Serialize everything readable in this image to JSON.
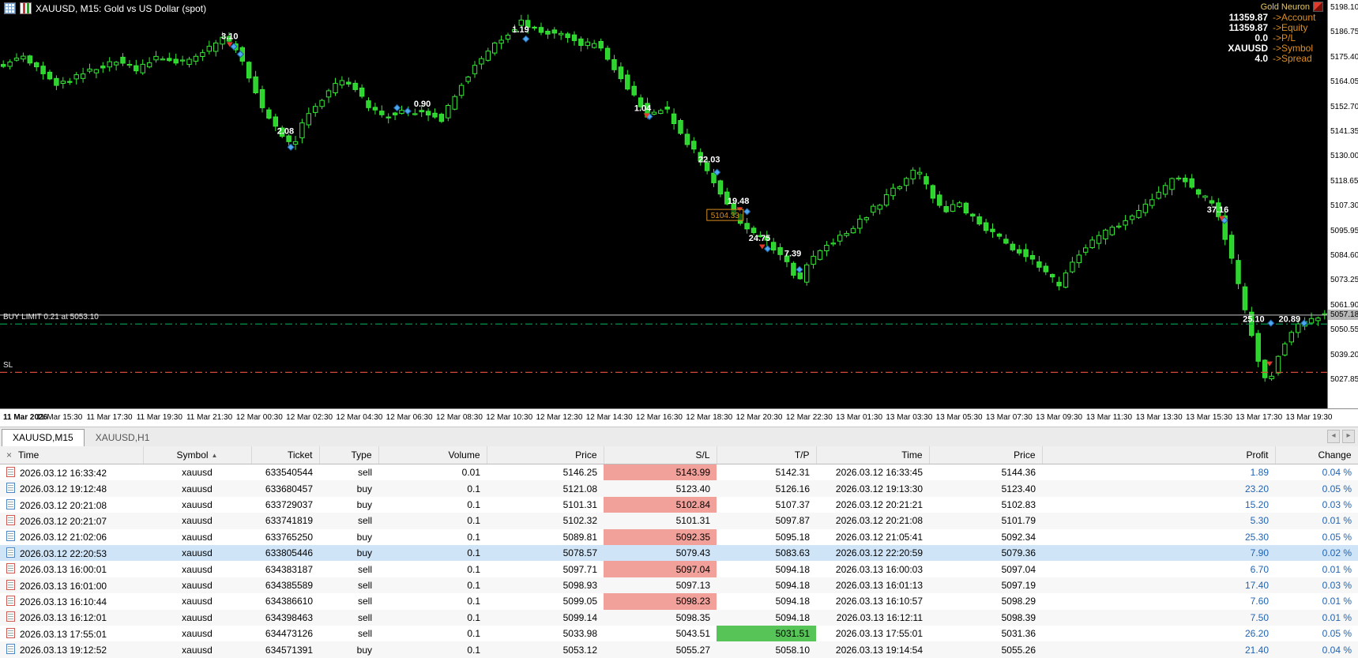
{
  "window_title": {
    "text": "XAUUSD, M15:  Gold vs US Dollar (spot)"
  },
  "gold_neuron": {
    "title": "Gold Neuron",
    "stats": [
      {
        "value": "11359.87",
        "label": "->Account"
      },
      {
        "value": "11359.87",
        "label": "->Equity"
      },
      {
        "value": "0.0",
        "label": "->P/L"
      },
      {
        "value": "XAUUSD",
        "label": "->Symbol"
      },
      {
        "value": "4.0",
        "label": "->Spread"
      }
    ]
  },
  "chart": {
    "type": "candlestick",
    "symbol": "XAUUSD",
    "timeframe": "M15",
    "price_labels": [
      "5198.10",
      "5186.75",
      "5175.40",
      "5164.05",
      "5152.70",
      "5141.35",
      "5130.00",
      "5118.65",
      "5107.30",
      "5095.95",
      "5084.60",
      "5073.25",
      "5061.90",
      "5050.55",
      "5039.20",
      "5027.85"
    ],
    "current_price": "5057.18",
    "current_price_value": 5057.18,
    "buy_limit": {
      "label": "BUY LIMIT 0.21 at 5053.10",
      "price": 5053.1
    },
    "stop_loss": {
      "label": "SL",
      "price": 5031.0
    },
    "order_price_tag": {
      "text": "5104.33",
      "x": 0.546,
      "price": 5103.0
    },
    "time_labels": [
      "11 Mar 2026",
      "11 Mar 15:30",
      "11 Mar 17:30",
      "11 Mar 19:30",
      "11 Mar 21:30",
      "12 Mar 00:30",
      "12 Mar 02:30",
      "12 Mar 04:30",
      "12 Mar 06:30",
      "12 Mar 08:30",
      "12 Mar 10:30",
      "12 Mar 12:30",
      "12 Mar 14:30",
      "12 Mar 16:30",
      "12 Mar 18:30",
      "12 Mar 20:30",
      "12 Mar 22:30",
      "13 Mar 01:30",
      "13 Mar 03:30",
      "13 Mar 05:30",
      "13 Mar 07:30",
      "13 Mar 09:30",
      "13 Mar 11:30",
      "13 Mar 13:30",
      "13 Mar 15:30",
      "13 Mar 17:30",
      "13 Mar 19:30"
    ],
    "anchors": [
      [
        0.0,
        5171
      ],
      [
        0.02,
        5175
      ],
      [
        0.045,
        5162
      ],
      [
        0.07,
        5169
      ],
      [
        0.09,
        5174
      ],
      [
        0.105,
        5169
      ],
      [
        0.12,
        5175
      ],
      [
        0.14,
        5173
      ],
      [
        0.16,
        5179
      ],
      [
        0.172,
        5185
      ],
      [
        0.185,
        5174
      ],
      [
        0.2,
        5152
      ],
      [
        0.215,
        5139
      ],
      [
        0.222,
        5134
      ],
      [
        0.235,
        5150
      ],
      [
        0.25,
        5160
      ],
      [
        0.262,
        5166
      ],
      [
        0.275,
        5156
      ],
      [
        0.29,
        5148
      ],
      [
        0.305,
        5150
      ],
      [
        0.32,
        5150
      ],
      [
        0.335,
        5147
      ],
      [
        0.35,
        5163
      ],
      [
        0.365,
        5175
      ],
      [
        0.38,
        5184
      ],
      [
        0.395,
        5191
      ],
      [
        0.41,
        5186
      ],
      [
        0.425,
        5187
      ],
      [
        0.44,
        5180
      ],
      [
        0.452,
        5182
      ],
      [
        0.465,
        5170
      ],
      [
        0.478,
        5159
      ],
      [
        0.49,
        5149
      ],
      [
        0.503,
        5152
      ],
      [
        0.515,
        5141
      ],
      [
        0.527,
        5130
      ],
      [
        0.541,
        5117
      ],
      [
        0.553,
        5106
      ],
      [
        0.565,
        5096
      ],
      [
        0.575,
        5093
      ],
      [
        0.587,
        5087
      ],
      [
        0.598,
        5079
      ],
      [
        0.603,
        5071
      ],
      [
        0.612,
        5082
      ],
      [
        0.625,
        5090
      ],
      [
        0.64,
        5094
      ],
      [
        0.655,
        5103
      ],
      [
        0.67,
        5111
      ],
      [
        0.685,
        5120
      ],
      [
        0.693,
        5124
      ],
      [
        0.703,
        5113
      ],
      [
        0.714,
        5104
      ],
      [
        0.722,
        5109
      ],
      [
        0.733,
        5103
      ],
      [
        0.747,
        5096
      ],
      [
        0.76,
        5090
      ],
      [
        0.775,
        5085
      ],
      [
        0.79,
        5076
      ],
      [
        0.8,
        5071
      ],
      [
        0.812,
        5084
      ],
      [
        0.825,
        5091
      ],
      [
        0.84,
        5097
      ],
      [
        0.855,
        5102
      ],
      [
        0.87,
        5110
      ],
      [
        0.884,
        5118
      ],
      [
        0.892,
        5121
      ],
      [
        0.902,
        5113
      ],
      [
        0.913,
        5110
      ],
      [
        0.92,
        5103
      ],
      [
        0.928,
        5087
      ],
      [
        0.936,
        5068
      ],
      [
        0.944,
        5050
      ],
      [
        0.952,
        5032
      ],
      [
        0.957,
        5025
      ],
      [
        0.963,
        5036
      ],
      [
        0.972,
        5046
      ],
      [
        0.98,
        5052
      ],
      [
        0.988,
        5055
      ],
      [
        1.0,
        5058
      ]
    ],
    "trade_labels": [
      {
        "x": 0.173,
        "price": 5184.8,
        "text": "3.10"
      },
      {
        "x": 0.215,
        "price": 5141.5,
        "text": "2.08"
      },
      {
        "x": 0.318,
        "price": 5154.0,
        "text": "0.90"
      },
      {
        "x": 0.392,
        "price": 5188.0,
        "text": "1.19"
      },
      {
        "x": 0.484,
        "price": 5152.0,
        "text": "1.04"
      },
      {
        "x": 0.534,
        "price": 5128.5,
        "text": "22.03"
      },
      {
        "x": 0.556,
        "price": 5109.5,
        "text": "19.48"
      },
      {
        "x": 0.572,
        "price": 5092.5,
        "text": "24.75"
      },
      {
        "x": 0.597,
        "price": 5085.5,
        "text": "7.39"
      },
      {
        "x": 0.917,
        "price": 5105.5,
        "text": "37.16"
      },
      {
        "x": 0.944,
        "price": 5055.6,
        "text": "25.10"
      },
      {
        "x": 0.971,
        "price": 5055.6,
        "text": "20.89"
      }
    ],
    "diamonds": [
      {
        "x": 0.176,
        "price": 5180
      },
      {
        "x": 0.181,
        "price": 5176.5
      },
      {
        "x": 0.219,
        "price": 5134
      },
      {
        "x": 0.299,
        "price": 5152
      },
      {
        "x": 0.307,
        "price": 5150.5
      },
      {
        "x": 0.396,
        "price": 5183.5
      },
      {
        "x": 0.489,
        "price": 5148
      },
      {
        "x": 0.54,
        "price": 5122.5
      },
      {
        "x": 0.5625,
        "price": 5104.5
      },
      {
        "x": 0.578,
        "price": 5087.5
      },
      {
        "x": 0.602,
        "price": 5078
      },
      {
        "x": 0.922,
        "price": 5100.5
      },
      {
        "x": 0.957,
        "price": 5053.5
      },
      {
        "x": 0.982,
        "price": 5053.5
      }
    ],
    "sell_arrows": [
      {
        "x": 0.173,
        "price": 5182
      },
      {
        "x": 0.487,
        "price": 5149.5
      },
      {
        "x": 0.557,
        "price": 5106.5
      },
      {
        "x": 0.574,
        "price": 5089.5
      },
      {
        "x": 0.92,
        "price": 5102.5
      },
      {
        "x": 0.956,
        "price": 5036
      }
    ],
    "colors": {
      "candle": "#35e835",
      "bull_fill": "#000000",
      "bear_fill": "#2fd32f",
      "buy_limit": "#00a550",
      "sl": "#d24a3c",
      "price_line": "#c4c4c4",
      "marker_blue": "#4fa8f0",
      "marker_red": "#e23b2e",
      "tag_orange": "#d98e1e"
    }
  },
  "tabs": [
    {
      "label": "XAUUSD,M15",
      "active": true
    },
    {
      "label": "XAUUSD,H1",
      "active": false
    }
  ],
  "tab_nav": {
    "left": "◂",
    "right": "▸"
  },
  "history": {
    "close_label": "×",
    "columns": [
      "Time",
      "Symbol",
      "Ticket",
      "Type",
      "Volume",
      "Price",
      "S/L",
      "T/P",
      "Time",
      "Price",
      "Profit",
      "Change"
    ],
    "symbol_sort_glyph": "▲",
    "rows": [
      {
        "time": "2026.03.12 16:33:42",
        "symbol": "xauusd",
        "ticket": "633540544",
        "type": "sell",
        "volume": "0.01",
        "price": "5146.25",
        "sl": "5143.99",
        "tp": "5142.31",
        "time2": "2026.03.12 16:33:45",
        "price2": "5144.36",
        "profit": "1.89",
        "change": "0.04 %",
        "sl_loss": true,
        "tp_win": false,
        "selected": false
      },
      {
        "time": "2026.03.12 19:12:48",
        "symbol": "xauusd",
        "ticket": "633680457",
        "type": "buy",
        "volume": "0.1",
        "price": "5121.08",
        "sl": "5123.40",
        "tp": "5126.16",
        "time2": "2026.03.12 19:13:30",
        "price2": "5123.40",
        "profit": "23.20",
        "change": "0.05 %",
        "sl_loss": true,
        "tp_win": false,
        "selected": false
      },
      {
        "time": "2026.03.12 20:21:08",
        "symbol": "xauusd",
        "ticket": "633729037",
        "type": "buy",
        "volume": "0.1",
        "price": "5101.31",
        "sl": "5102.84",
        "tp": "5107.37",
        "time2": "2026.03.12 20:21:21",
        "price2": "5102.83",
        "profit": "15.20",
        "change": "0.03 %",
        "sl_loss": true,
        "tp_win": false,
        "selected": false
      },
      {
        "time": "2026.03.12 20:21:07",
        "symbol": "xauusd",
        "ticket": "633741819",
        "type": "sell",
        "volume": "0.1",
        "price": "5102.32",
        "sl": "5101.31",
        "tp": "5097.87",
        "time2": "2026.03.12 20:21:08",
        "price2": "5101.79",
        "profit": "5.30",
        "change": "0.01 %",
        "sl_loss": true,
        "tp_win": false,
        "selected": false
      },
      {
        "time": "2026.03.12 21:02:06",
        "symbol": "xauusd",
        "ticket": "633765250",
        "type": "buy",
        "volume": "0.1",
        "price": "5089.81",
        "sl": "5092.35",
        "tp": "5095.18",
        "time2": "2026.03.12 21:05:41",
        "price2": "5092.34",
        "profit": "25.30",
        "change": "0.05 %",
        "sl_loss": true,
        "tp_win": false,
        "selected": false
      },
      {
        "time": "2026.03.12 22:20:53",
        "symbol": "xauusd",
        "ticket": "633805446",
        "type": "buy",
        "volume": "0.1",
        "price": "5078.57",
        "sl": "5079.43",
        "tp": "5083.63",
        "time2": "2026.03.12 22:20:59",
        "price2": "5079.36",
        "profit": "7.90",
        "change": "0.02 %",
        "sl_loss": false,
        "tp_win": false,
        "selected": true
      },
      {
        "time": "2026.03.13 16:00:01",
        "symbol": "xauusd",
        "ticket": "634383187",
        "type": "sell",
        "volume": "0.1",
        "price": "5097.71",
        "sl": "5097.04",
        "tp": "5094.18",
        "time2": "2026.03.13 16:00:03",
        "price2": "5097.04",
        "profit": "6.70",
        "change": "0.01 %",
        "sl_loss": true,
        "tp_win": false,
        "selected": false
      },
      {
        "time": "2026.03.13 16:01:00",
        "symbol": "xauusd",
        "ticket": "634385589",
        "type": "sell",
        "volume": "0.1",
        "price": "5098.93",
        "sl": "5097.13",
        "tp": "5094.18",
        "time2": "2026.03.13 16:01:13",
        "price2": "5097.19",
        "profit": "17.40",
        "change": "0.03 %",
        "sl_loss": true,
        "tp_win": false,
        "selected": false
      },
      {
        "time": "2026.03.13 16:10:44",
        "symbol": "xauusd",
        "ticket": "634386610",
        "type": "sell",
        "volume": "0.1",
        "price": "5099.05",
        "sl": "5098.23",
        "tp": "5094.18",
        "time2": "2026.03.13 16:10:57",
        "price2": "5098.29",
        "profit": "7.60",
        "change": "0.01 %",
        "sl_loss": true,
        "tp_win": false,
        "selected": false
      },
      {
        "time": "2026.03.13 16:12:01",
        "symbol": "xauusd",
        "ticket": "634398463",
        "type": "sell",
        "volume": "0.1",
        "price": "5099.14",
        "sl": "5098.35",
        "tp": "5094.18",
        "time2": "2026.03.13 16:12:11",
        "price2": "5098.39",
        "profit": "7.50",
        "change": "0.01 %",
        "sl_loss": true,
        "tp_win": false,
        "selected": false
      },
      {
        "time": "2026.03.13 17:55:01",
        "symbol": "xauusd",
        "ticket": "634473126",
        "type": "sell",
        "volume": "0.1",
        "price": "5033.98",
        "sl": "5043.51",
        "tp": "5031.51",
        "time2": "2026.03.13 17:55:01",
        "price2": "5031.36",
        "profit": "26.20",
        "change": "0.05 %",
        "sl_loss": false,
        "tp_win": true,
        "selected": false
      },
      {
        "time": "2026.03.13 19:12:52",
        "symbol": "xauusd",
        "ticket": "634571391",
        "type": "buy",
        "volume": "0.1",
        "price": "5053.12",
        "sl": "5055.27",
        "tp": "5058.10",
        "time2": "2026.03.13 19:14:54",
        "price2": "5055.26",
        "profit": "21.40",
        "change": "0.04 %",
        "sl_loss": true,
        "tp_win": false,
        "selected": false
      }
    ]
  }
}
